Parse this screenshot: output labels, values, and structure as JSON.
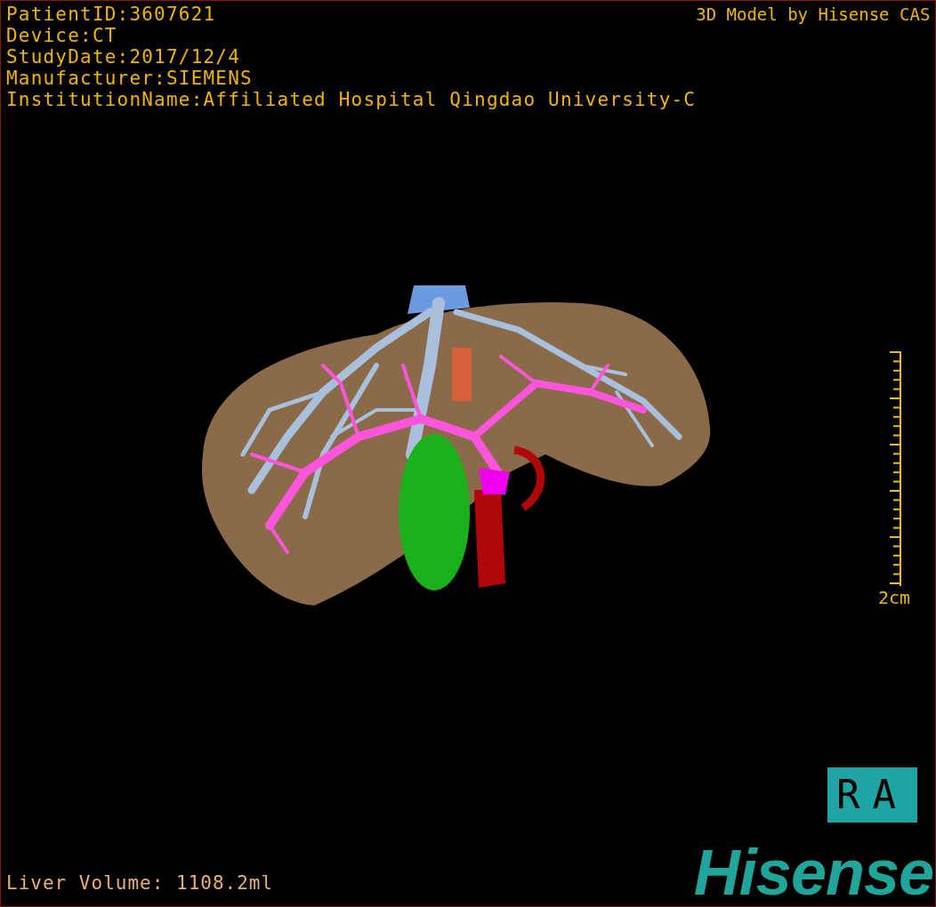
{
  "info_lines": [
    "PatientID:3607621",
    "Device:CT",
    "StudyDate:2017/12/4",
    "Manufacturer:SIEMENS",
    "InstitutionName:Affiliated Hospital Qingdao University-C"
  ],
  "model_title": "3D Model by Hisense CAS",
  "scale_bar": {
    "label": "2cm"
  },
  "liver_volume": "Liver Volume: 1108.2ml",
  "orientation_label": "RA",
  "logo": "Hisense"
}
